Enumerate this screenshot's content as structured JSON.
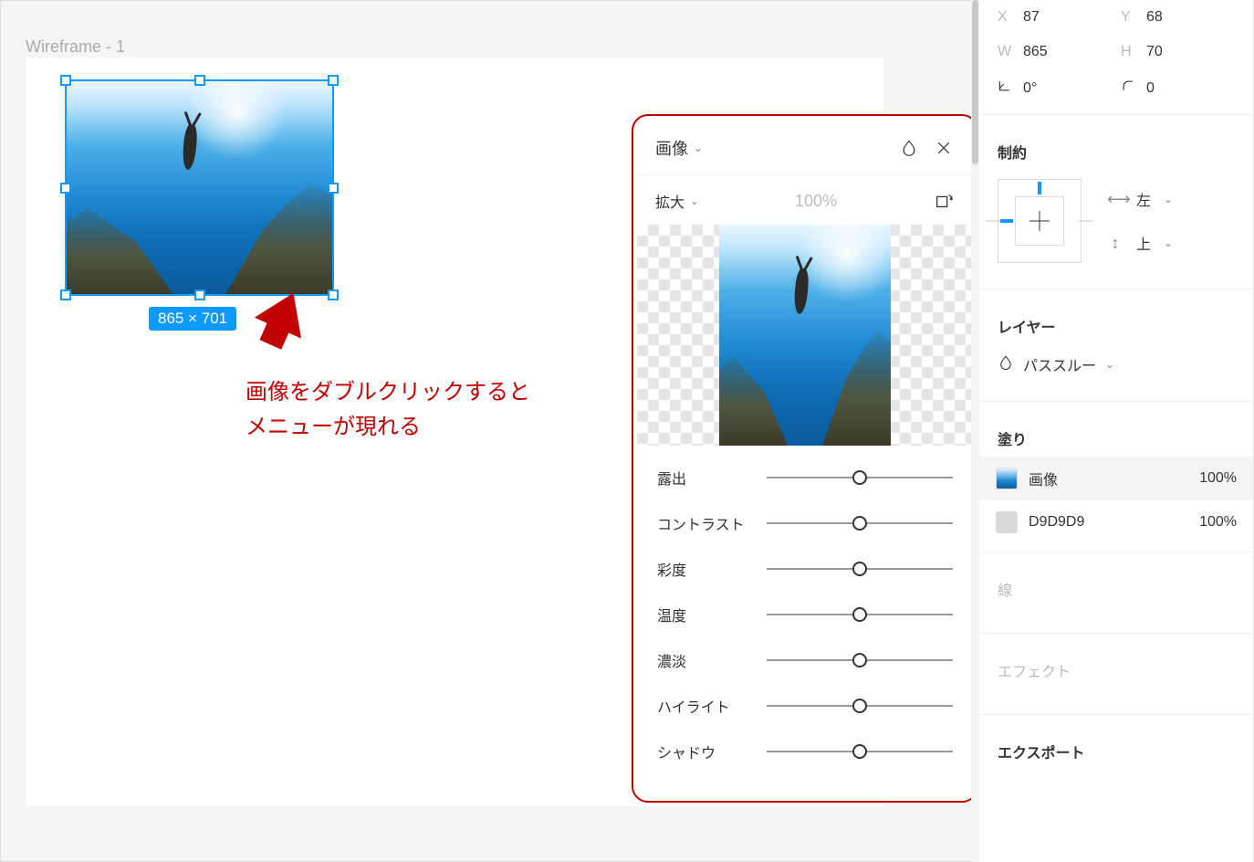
{
  "canvas": {
    "frame_label": "Wireframe - 1",
    "size_badge": "865 × 701",
    "annotation_line1": "画像をダブルクリックすると",
    "annotation_line2": "メニューが現れる"
  },
  "image_panel": {
    "title": "画像",
    "fill_mode": "拡大",
    "zoom": "100%",
    "sliders": [
      {
        "label": "露出"
      },
      {
        "label": "コントラスト"
      },
      {
        "label": "彩度"
      },
      {
        "label": "温度"
      },
      {
        "label": "濃淡"
      },
      {
        "label": "ハイライト"
      },
      {
        "label": "シャドウ"
      }
    ]
  },
  "props": {
    "x_label": "X",
    "x": "87",
    "y_label": "Y",
    "y": "68",
    "w_label": "W",
    "w": "865",
    "h_label": "H",
    "h": "70",
    "rot": "0°",
    "radius": "0",
    "constraints_title": "制約",
    "horiz": "左",
    "vert": "上",
    "layer_title": "レイヤー",
    "blend_mode": "パススルー",
    "fill_title": "塗り",
    "fill_image": "画像",
    "fill_image_pct": "100%",
    "fill_color": "D9D9D9",
    "fill_color_pct": "100%",
    "stroke_title": "線",
    "effects_title": "エフェクト",
    "export_title": "エクスポート"
  }
}
